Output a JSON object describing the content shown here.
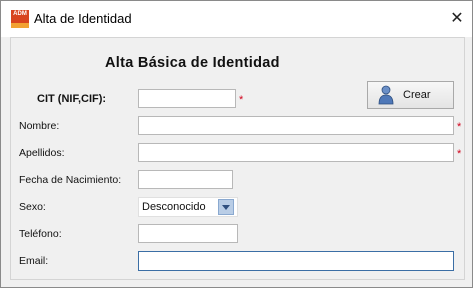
{
  "window": {
    "title": "Alta de Identidad",
    "icon_text": "ADM",
    "close_glyph": "✕"
  },
  "form": {
    "heading": "Alta Básica de Identidad",
    "cit_label": "CIT (NIF,CIF):",
    "nombre_label": "Nombre:",
    "apellidos_label": "Apellidos:",
    "fecha_label": "Fecha de Nacimiento:",
    "sexo_label": "Sexo:",
    "sexo_value": "Desconocido",
    "telefono_label": "Teléfono:",
    "email_label": "Email:",
    "required_mark": "*",
    "cit_value": "",
    "nombre_value": "",
    "apellidos_value": "",
    "fecha_value": "",
    "telefono_value": "",
    "email_value": ""
  },
  "buttons": {
    "crear_label": "Crear",
    "crear_icon": "user-icon"
  },
  "colors": {
    "required": "#d0021b",
    "focus_border": "#3b6ea5"
  }
}
